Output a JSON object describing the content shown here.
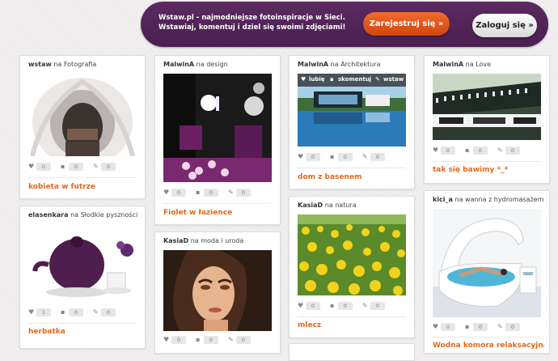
{
  "banner": {
    "text": "Wstaw.pl - najmodniejsze fotoinspiracje w Sieci. Wstawiaj, komentuj i dziel się swoimi zdjęciami!",
    "register_label": "Zarejestruj się »",
    "login_label": "Zaloguj się »"
  },
  "hover": {
    "like": "lubię",
    "comment": "skomentuj",
    "insert": "wstaw"
  },
  "cards": [
    {
      "user": "wstaw",
      "on": "na",
      "board": "Fotografia",
      "caption": "kobieta w futrze",
      "likes": "0",
      "comments": "0",
      "pins": "0"
    },
    {
      "user": "elasenkara",
      "on": "na",
      "board": "Słodkie pyszności",
      "caption": "herbatka",
      "likes": "1",
      "comments": "0",
      "pins": "0"
    },
    {
      "user": "MalwinA",
      "on": "na",
      "board": "design",
      "caption": "Fiolet w łazience",
      "likes": "0",
      "comments": "0",
      "pins": "0"
    },
    {
      "user": "KasiaD",
      "on": "na",
      "board": "moda i uroda",
      "caption": "",
      "likes": "0",
      "comments": "0",
      "pins": "0"
    },
    {
      "user": "MalwinA",
      "on": "na",
      "board": "Architektura",
      "caption": "dom z basenem",
      "likes": "0",
      "comments": "0",
      "pins": "0"
    },
    {
      "user": "KasiaD",
      "on": "na",
      "board": "natura",
      "caption": "mlecz",
      "likes": "0",
      "comments": "0",
      "pins": "0"
    },
    {
      "user": "MalwinA",
      "on": "na",
      "board": "Love",
      "caption": "tak się bawimy *_*",
      "likes": "0",
      "comments": "0",
      "pins": "0"
    },
    {
      "user": "kici_a",
      "on": "na",
      "board": "wanna z hydromasażem",
      "caption": "Wodna komora relaksacyjna",
      "likes": "0",
      "comments": "0",
      "pins": "0"
    }
  ],
  "icons": {
    "like": "heart-icon",
    "comment": "comment-icon",
    "pin": "pin-icon"
  },
  "colors": {
    "banner": "#4a1f50",
    "accent": "#e06a1e",
    "register": "#e0561a"
  }
}
